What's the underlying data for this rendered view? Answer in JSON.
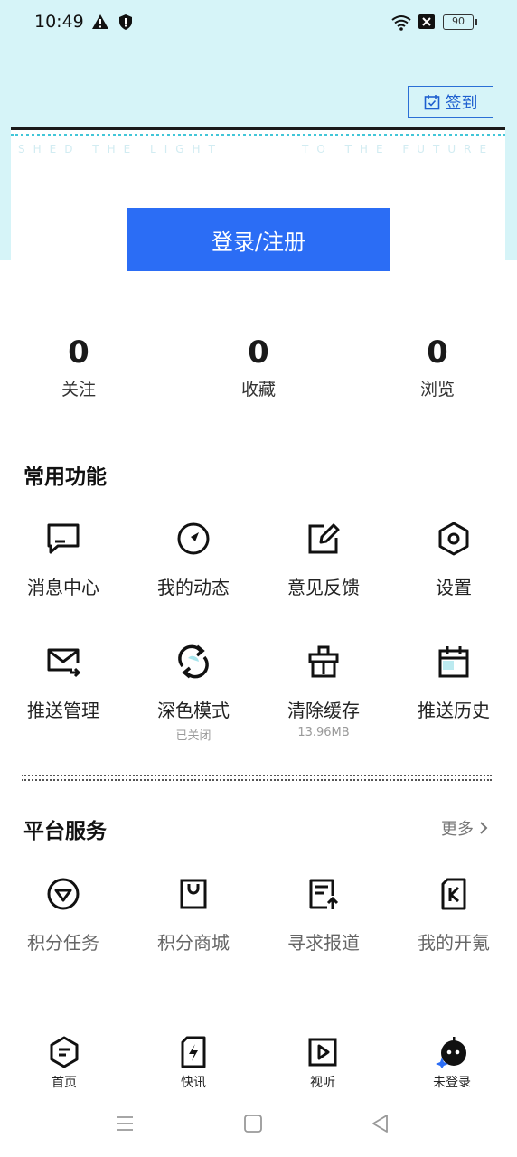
{
  "status_bar": {
    "time": "10:49",
    "battery": "90"
  },
  "header": {
    "checkin_label": "签到",
    "banner_left_text": "SHED THE LIGHT",
    "banner_right_text": "TO THE FUTURE",
    "login_label": "登录/注册"
  },
  "stats": [
    {
      "value": "0",
      "label": "关注"
    },
    {
      "value": "0",
      "label": "收藏"
    },
    {
      "value": "0",
      "label": "浏览"
    }
  ],
  "common": {
    "title": "常用功能",
    "items": [
      {
        "label": "消息中心",
        "icon": "message-icon"
      },
      {
        "label": "我的动态",
        "icon": "compass-icon"
      },
      {
        "label": "意见反馈",
        "icon": "edit-icon"
      },
      {
        "label": "设置",
        "icon": "settings-icon"
      },
      {
        "label": "推送管理",
        "icon": "mail-send-icon"
      },
      {
        "label": "深色模式",
        "sub": "已关闭",
        "icon": "refresh-icon"
      },
      {
        "label": "清除缓存",
        "sub": "13.96MB",
        "icon": "broom-icon"
      },
      {
        "label": "推送历史",
        "icon": "calendar-icon"
      }
    ]
  },
  "platform": {
    "title": "平台服务",
    "more_label": "更多",
    "items": [
      {
        "label": "积分任务",
        "icon": "diamond-icon"
      },
      {
        "label": "积分商城",
        "icon": "shopping-bag-icon"
      },
      {
        "label": "寻求报道",
        "icon": "report-icon"
      },
      {
        "label": "我的开氪",
        "icon": "k-card-icon"
      }
    ]
  },
  "bottom_nav": [
    {
      "label": "首页",
      "icon": "home-hex-icon"
    },
    {
      "label": "快讯",
      "icon": "flash-icon"
    },
    {
      "label": "视听",
      "icon": "play-icon"
    },
    {
      "label": "未登录",
      "icon": "robot-avatar-icon"
    }
  ],
  "colors": {
    "accent": "#2b6df5",
    "header_bg": "#d6f4f8",
    "dotted_accent": "#43c6d8"
  }
}
